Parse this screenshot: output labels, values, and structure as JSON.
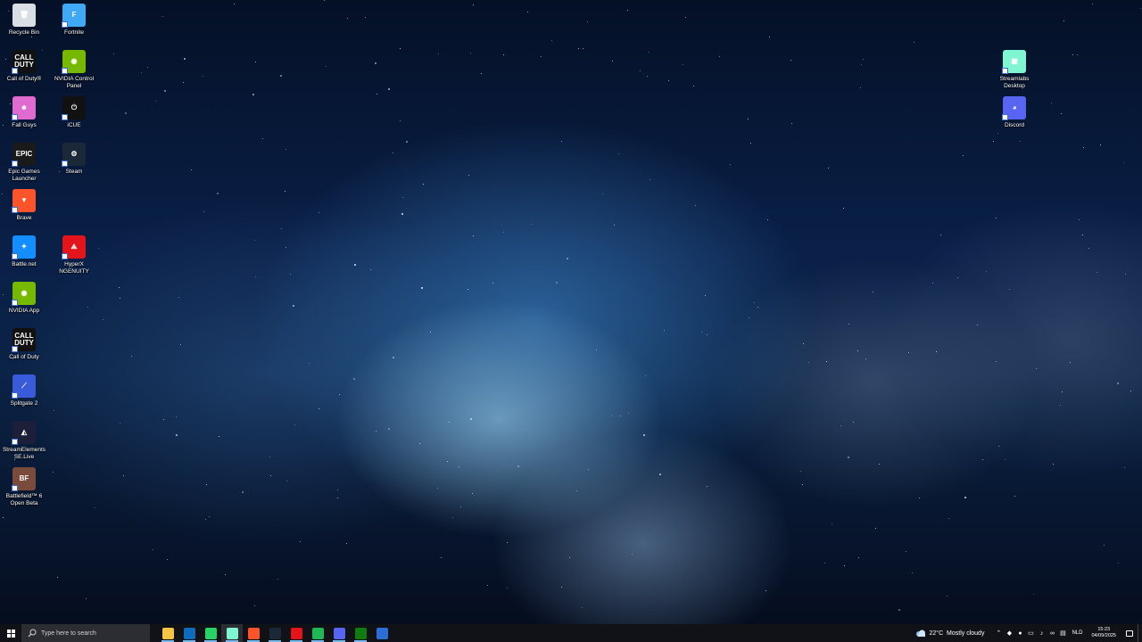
{
  "desktop_icons_left": [
    {
      "id": "recycle-bin",
      "label": "Recycle Bin",
      "icon": "recycle-bin-icon",
      "color": "#d9dde4"
    },
    {
      "id": "fortnite",
      "label": "Fortnite",
      "icon": "fortnite-icon",
      "color": "#3fa9f5"
    },
    {
      "id": "call-of-duty-1",
      "label": "Call of Duty®",
      "icon": "call-of-duty-icon",
      "color": "#111111"
    },
    {
      "id": "nvidia-control-panel",
      "label": "NVIDIA Control Panel",
      "icon": "nvidia-icon",
      "color": "#76b900"
    },
    {
      "id": "fall-guys",
      "label": "Fall Guys",
      "icon": "fall-guys-icon",
      "color": "#e06bd0"
    },
    {
      "id": "icue",
      "label": "iCUE",
      "icon": "icue-icon",
      "color": "#111111"
    },
    {
      "id": "epic-games",
      "label": "Epic Games Launcher",
      "icon": "epic-games-icon",
      "color": "#1a1a1a"
    },
    {
      "id": "steam",
      "label": "Steam",
      "icon": "steam-icon",
      "color": "#1b2838"
    },
    {
      "id": "brave",
      "label": "Brave",
      "icon": "brave-icon",
      "color": "#fb542b"
    },
    {
      "id": "battle-net",
      "label": "Battle.net",
      "icon": "battlenet-icon",
      "color": "#148eff"
    },
    {
      "id": "hyperx",
      "label": "HyperX NGENUITY",
      "icon": "hyperx-icon",
      "color": "#e3151b"
    },
    {
      "id": "nvidia-app",
      "label": "NVIDIA App",
      "icon": "nvidia-icon",
      "color": "#76b900"
    },
    {
      "id": "call-of-duty-2",
      "label": "Call of Duty",
      "icon": "call-of-duty-icon",
      "color": "#111111"
    },
    {
      "id": "splitgate",
      "label": "Splitgate 2",
      "icon": "splitgate-icon",
      "color": "#3a5bd9"
    },
    {
      "id": "streamelements",
      "label": "StreamElements SE.Live",
      "icon": "streamelements-icon",
      "color": "#1d1f3a"
    },
    {
      "id": "battlefield",
      "label": "Battlefield™ 6 Open Beta",
      "icon": "battlefield-icon",
      "color": "#7a4a3a"
    }
  ],
  "desktop_icons_right": [
    {
      "id": "streamlabs",
      "label": "Streamlabs Desktop",
      "icon": "streamlabs-icon",
      "color": "#80f5d2"
    },
    {
      "id": "discord",
      "label": "Discord",
      "icon": "discord-icon",
      "color": "#5865f2"
    }
  ],
  "taskbar": {
    "search_placeholder": "Type here to search",
    "pinned_apps": [
      {
        "name": "file-explorer",
        "icon": "folder-icon",
        "color": "#f4c542"
      },
      {
        "name": "outlook",
        "icon": "outlook-icon",
        "color": "#0f6cbd"
      },
      {
        "name": "whatsapp",
        "icon": "whatsapp-icon",
        "color": "#25d366"
      },
      {
        "name": "streamlabs",
        "icon": "streamlabs-icon",
        "color": "#80f5d2"
      },
      {
        "name": "brave",
        "icon": "brave-icon",
        "color": "#fb542b"
      },
      {
        "name": "steam",
        "icon": "steam-icon",
        "color": "#1b2838"
      },
      {
        "name": "red-app",
        "icon": "app-icon",
        "color": "#e3151b"
      },
      {
        "name": "spotify",
        "icon": "spotify-icon",
        "color": "#1db954"
      },
      {
        "name": "discord",
        "icon": "discord-icon",
        "color": "#5865f2"
      },
      {
        "name": "xbox",
        "icon": "xbox-icon",
        "color": "#107c10"
      },
      {
        "name": "window-app",
        "icon": "window-icon",
        "color": "#2b6fd6"
      }
    ],
    "weather": {
      "temp": "22°C",
      "condition": "Mostly cloudy"
    },
    "language": "NLD",
    "time": "15:23",
    "date": "04/09/2025"
  }
}
